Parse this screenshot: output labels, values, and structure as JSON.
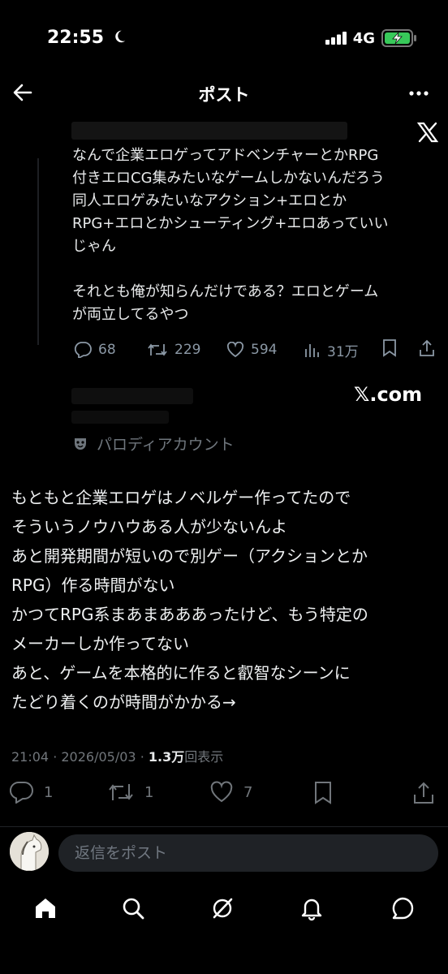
{
  "status_bar": {
    "time": "22:55",
    "network": "4G"
  },
  "header": {
    "title": "ポスト"
  },
  "quoted_post": {
    "text": "なんで企業エロゲってアドベンチャーとかRPG\n付きエロCG集みたいなゲームしかないんだろう\n同人エロゲみたいなアクション+エロとか\nRPG+エロとかシューティング+エロあっていい\nじゃん\n\nそれとも俺が知らんだけである？エロとゲーム\nが両立してるやつ",
    "replies": "68",
    "reposts": "229",
    "likes": "594",
    "views": "31万"
  },
  "watermark": {
    "text": "𝕏.com"
  },
  "author": {
    "badge_label": "パロディアカウント"
  },
  "post": {
    "text": "もともと企業エロゲはノベルゲー作ってたので\nそういうノウハウある人が少ないんよ\nあと開発期間が短いので別ゲー（アクションとか\nRPG）作る時間がない\nかつてRPG系まあまあああったけど、もう特定の\nメーカーしか作ってない\nあと、ゲームを本格的に作ると叡智なシーンに\nたどり着くのが時間がかかる→",
    "time": "21:04",
    "date": "2026/05/03",
    "views_count": "1.3万",
    "views_label": "回表示",
    "replies": "1",
    "reposts": "1",
    "likes": "7"
  },
  "reply_box": {
    "placeholder": "返信をポスト"
  },
  "colors": {
    "background": "#000000",
    "text": "#e7e9ea",
    "muted": "#71767b"
  }
}
